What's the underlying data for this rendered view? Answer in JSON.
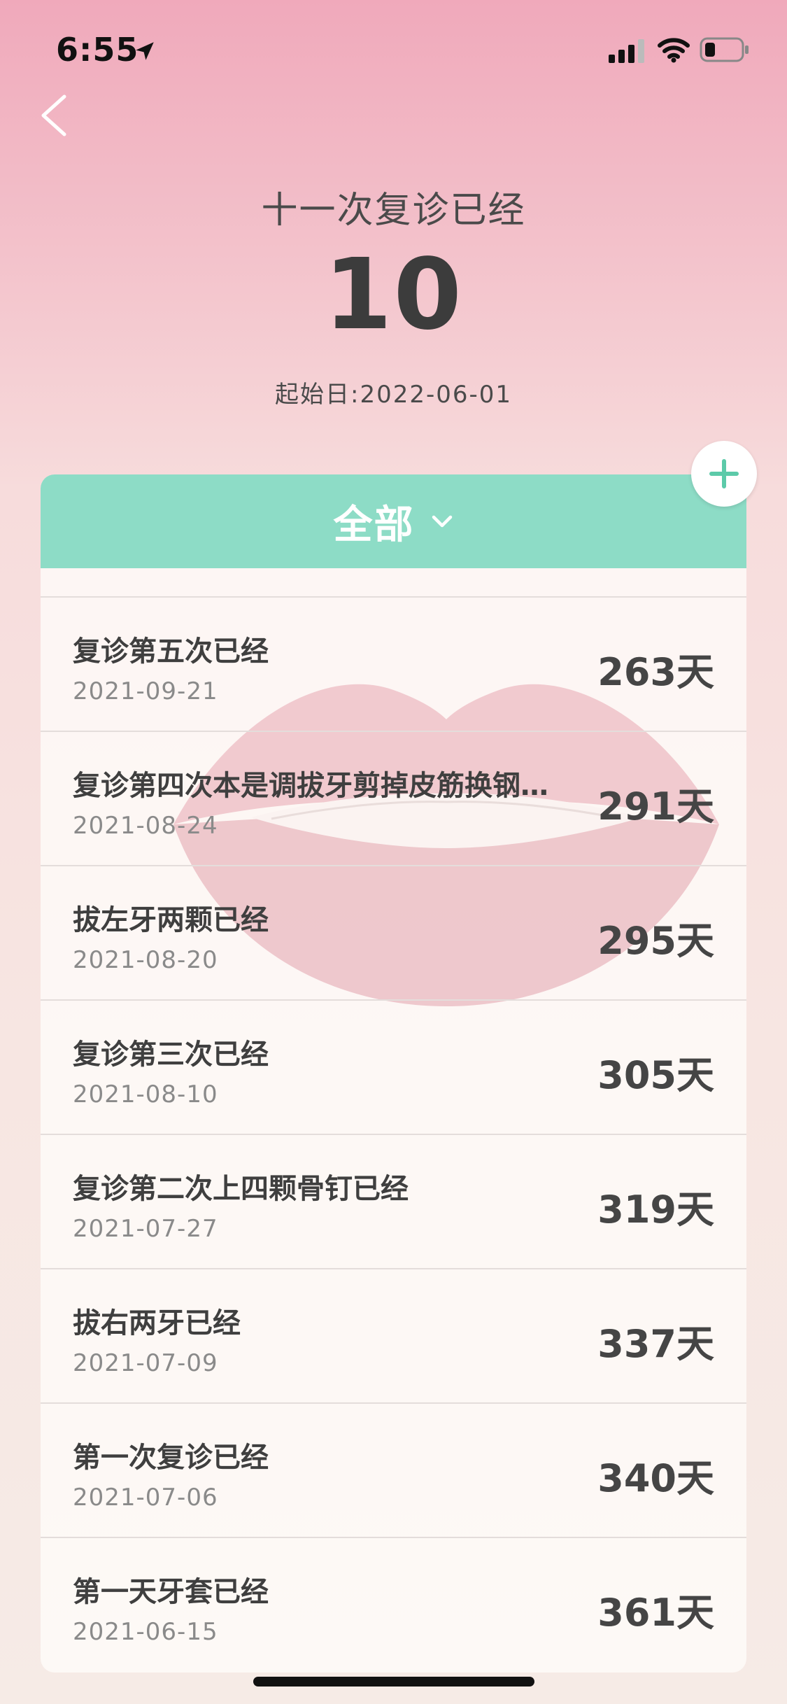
{
  "status_bar": {
    "time": "6:55"
  },
  "header": {
    "title": "十一次复诊已经",
    "count": "10",
    "start_label": "起始日:",
    "start_date": "2022-06-01"
  },
  "filter": {
    "label": "全部"
  },
  "items": [
    {
      "title": "复诊第五次已经",
      "date": "2021-09-21",
      "days": "263",
      "unit": "天"
    },
    {
      "title": "复诊第四次本是调拔牙剪掉皮筋换钢…",
      "date": "2021-08-24",
      "days": "291",
      "unit": "天"
    },
    {
      "title": "拔左牙两颗已经",
      "date": "2021-08-20",
      "days": "295",
      "unit": "天"
    },
    {
      "title": "复诊第三次已经",
      "date": "2021-08-10",
      "days": "305",
      "unit": "天"
    },
    {
      "title": "复诊第二次上四颗骨钉已经",
      "date": "2021-07-27",
      "days": "319",
      "unit": "天"
    },
    {
      "title": "拔右两牙已经",
      "date": "2021-07-09",
      "days": "337",
      "unit": "天"
    },
    {
      "title": "第一次复诊已经",
      "date": "2021-07-06",
      "days": "340",
      "unit": "天"
    },
    {
      "title": "第一天牙套已经",
      "date": "2021-06-15",
      "days": "361",
      "unit": "天"
    }
  ],
  "colors": {
    "accent": "#8ddcc6",
    "add_icon": "#5ccaa9"
  },
  "icons": [
    "location-arrow-icon",
    "signal-icon",
    "wifi-icon",
    "battery-icon",
    "back-chevron-icon",
    "chevron-down-icon",
    "plus-icon"
  ]
}
